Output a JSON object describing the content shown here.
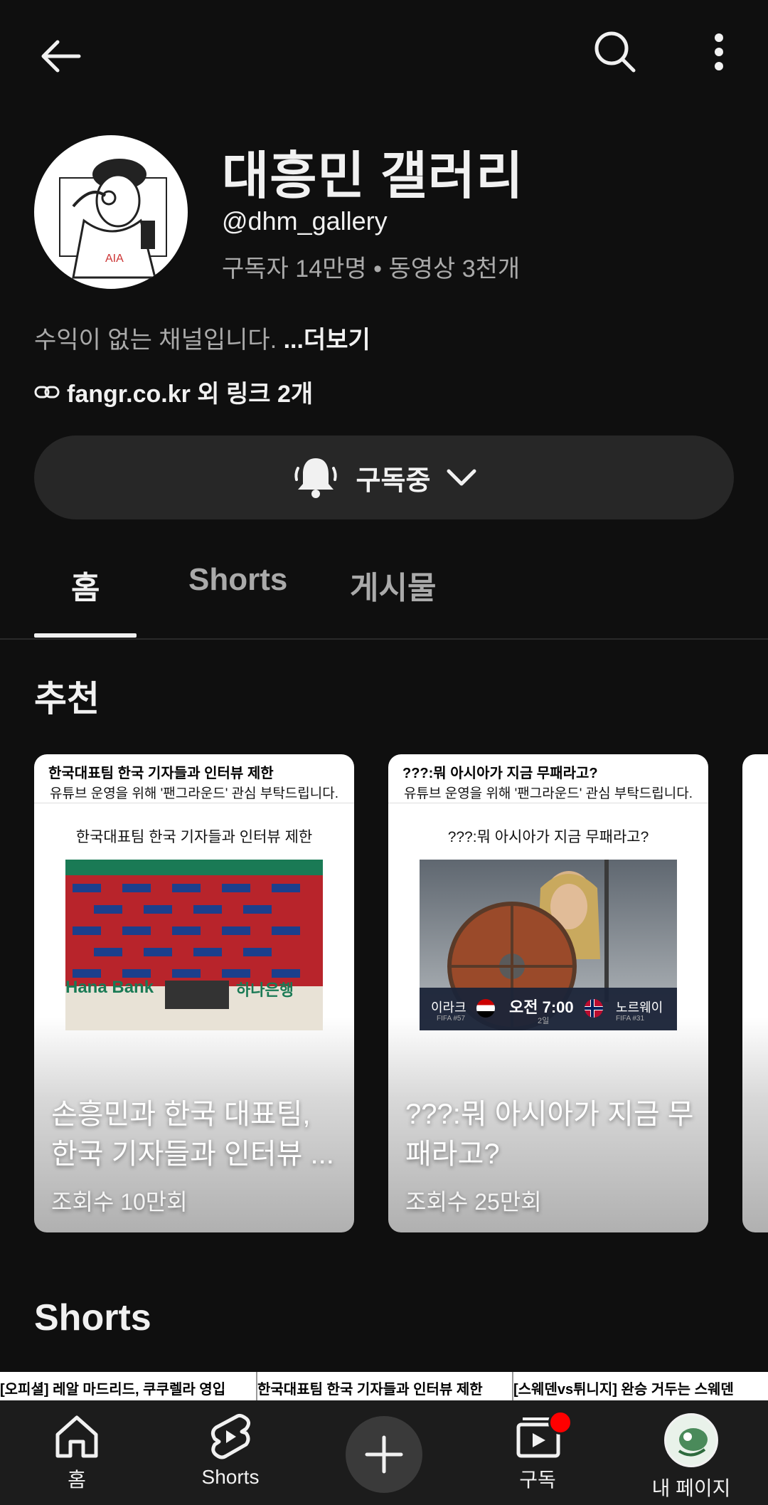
{
  "channel": {
    "name": "대흥민 갤러리",
    "handle": "@dhm_gallery",
    "stats": "구독자 14만명 • 동영상 3천개",
    "description": "수익이 없는 채널입니다. ",
    "more_label": "...더보기",
    "links": "fangr.co.kr 외 링크 2개",
    "subscribe_label": "구독중"
  },
  "tabs": [
    {
      "label": "홈"
    },
    {
      "label": "Shorts"
    },
    {
      "label": "게시물"
    }
  ],
  "sections": {
    "recommended_title": "추천",
    "shorts_title": "Shorts"
  },
  "videos": [
    {
      "header_title": "한국대표팀 한국 기자들과 인터뷰 제한",
      "header_sub": "유튜브 운영을 위해 '팬그라운드' 관심 부탁드립니다.",
      "inner_title": "한국대표팀 한국 기자들과 인터뷰 제한",
      "title": "손흥민과 한국 대표팀, 한국 기자들과 인터뷰 ...",
      "views": "조회수 10만회",
      "banner_text": "Hana Bank",
      "banner_text2": "하나은행"
    },
    {
      "header_title": "???:뭐 아시아가 지금 무패라고?",
      "header_sub": "유튜브 운영을 위해 '팬그라운드' 관심 부탁드립니다.",
      "inner_title": "???:뭐 아시아가 지금 무패라고?",
      "title": "???:뭐 아시아가 지금 무패라고?",
      "views": "조회수 25만회",
      "match": {
        "team1": "이라크",
        "team1_rank": "FIFA #57",
        "time": "오전 7:00",
        "day": "2일",
        "team2": "노르웨이",
        "team2_rank": "FIFA #31"
      }
    }
  ],
  "shorts_strip": [
    "[오피셜] 레알 마드리드, 쿠쿠렐라 영입",
    "한국대표팀 한국 기자들과 인터뷰 제한",
    "[스웨덴vs튀니지] 완승 거두는 스웨덴"
  ],
  "bottom_nav": {
    "home": "홈",
    "shorts": "Shorts",
    "subscriptions": "구독",
    "you": "내 페이지"
  },
  "colors": {
    "background": "#0f0f0f",
    "surface": "#272727",
    "notification": "#ff0000"
  }
}
